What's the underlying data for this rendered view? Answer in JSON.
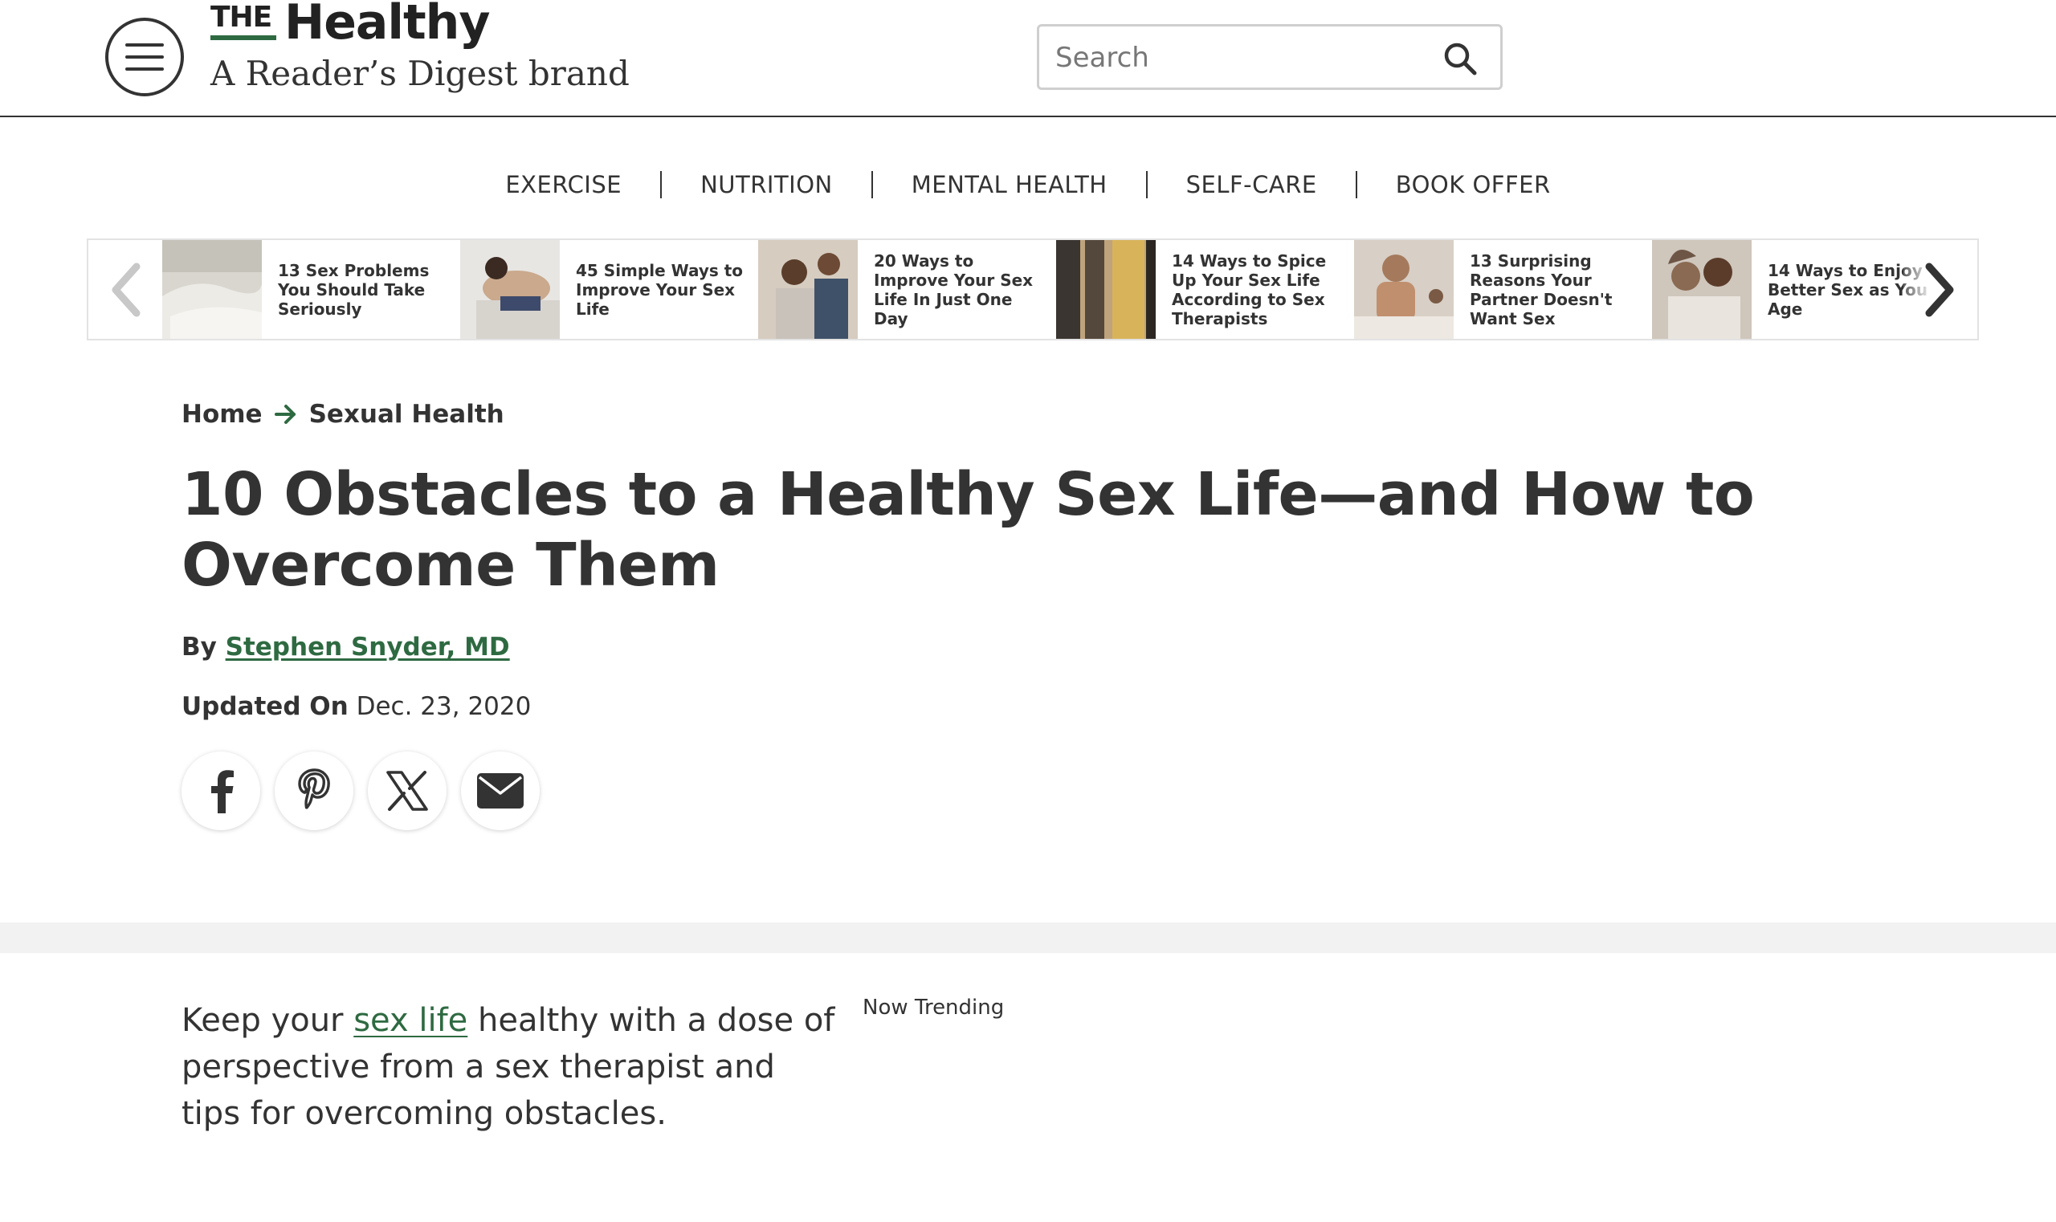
{
  "header": {
    "logo_the": "THE",
    "logo_name": "Healthy",
    "logo_tagline": "A Reader’s Digest brand",
    "search_placeholder": "Search"
  },
  "nav": {
    "items": [
      "EXERCISE",
      "NUTRITION",
      "MENTAL HEALTH",
      "SELF-CARE",
      "BOOK OFFER"
    ]
  },
  "carousel": {
    "items": [
      {
        "title": "13 Sex Problems You Should Take Seriously"
      },
      {
        "title": "45 Simple Ways to Improve Your Sex Life"
      },
      {
        "title": "20 Ways to Improve Your Sex Life In Just One Day"
      },
      {
        "title": "14 Ways to Spice Up Your Sex Life According to Sex Therapists"
      },
      {
        "title": "13 Surprising Reasons Your Partner Doesn't Want Sex"
      },
      {
        "title": "14 Ways to Enjoy Better Sex as You Age"
      }
    ]
  },
  "breadcrumb": {
    "home": "Home",
    "section": "Sexual Health"
  },
  "article": {
    "title": "10 Obstacles to a Healthy Sex Life—and How to Overcome Them",
    "by_label": "By",
    "author": "Stephen Snyder, MD",
    "updated_label": "Updated On",
    "updated_date": "Dec. 23, 2020",
    "intro_before": "Keep your ",
    "intro_link": "sex life",
    "intro_after": " healthy with a dose of perspective from a sex therapist and tips for overcoming obstacles."
  },
  "sidebar": {
    "trending_label": "Now Trending"
  },
  "colors": {
    "brand_green": "#2e6a41",
    "text": "#333333"
  },
  "icons": {
    "menu": "hamburger-menu-icon",
    "search": "search-icon",
    "prev": "chevron-left-icon",
    "next": "chevron-right-icon",
    "breadcrumb": "arrow-right-icon",
    "share": [
      "facebook-icon",
      "pinterest-icon",
      "x-icon",
      "email-icon"
    ]
  }
}
